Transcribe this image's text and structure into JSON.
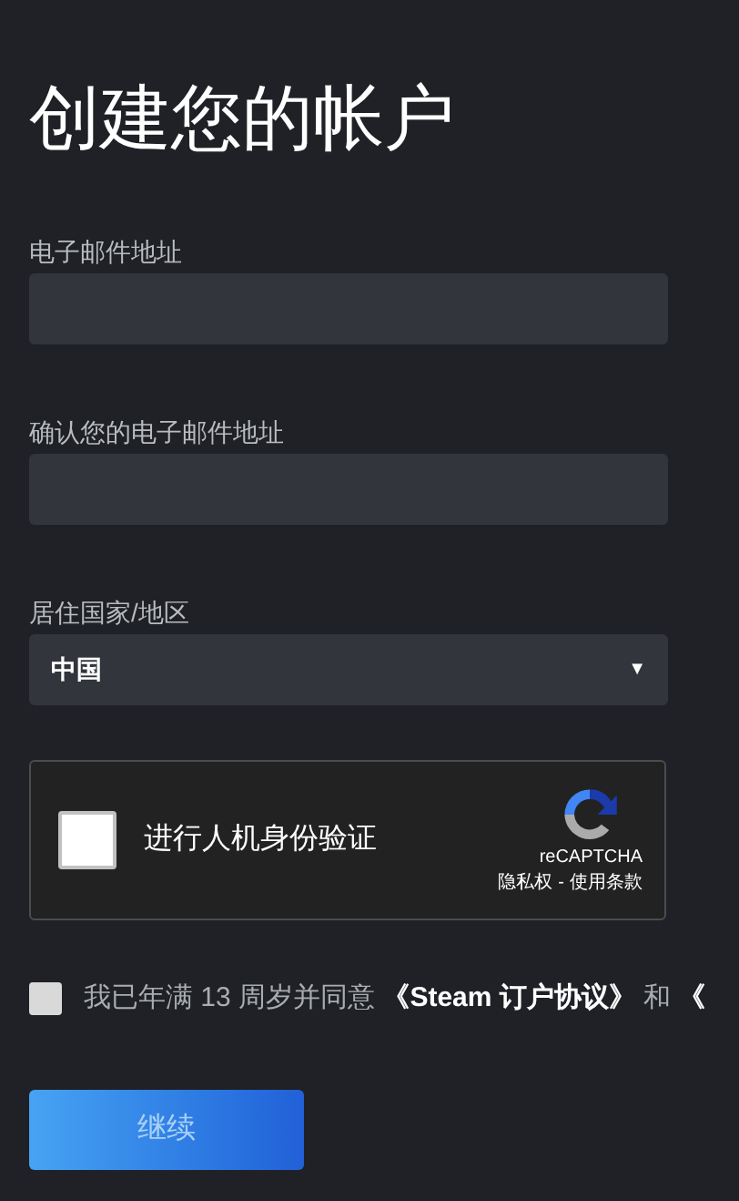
{
  "title": "创建您的帐户",
  "fields": [
    {
      "label": "电子邮件地址"
    },
    {
      "label": "确认您的电子邮件地址"
    }
  ],
  "country": {
    "label": "居住国家/地区",
    "value": "中国",
    "caret": "▼"
  },
  "captcha": {
    "checked": false,
    "label": "进行人机身份验证",
    "brand": "reCAPTCHA",
    "privacy": "隐私权",
    "separator": "-",
    "terms": "使用条款"
  },
  "agreement": {
    "checked": false,
    "text": "我已年满 13 周岁并同意 **《Steam 订户协议》** 和 **《**"
  },
  "continue_button": "继续"
}
